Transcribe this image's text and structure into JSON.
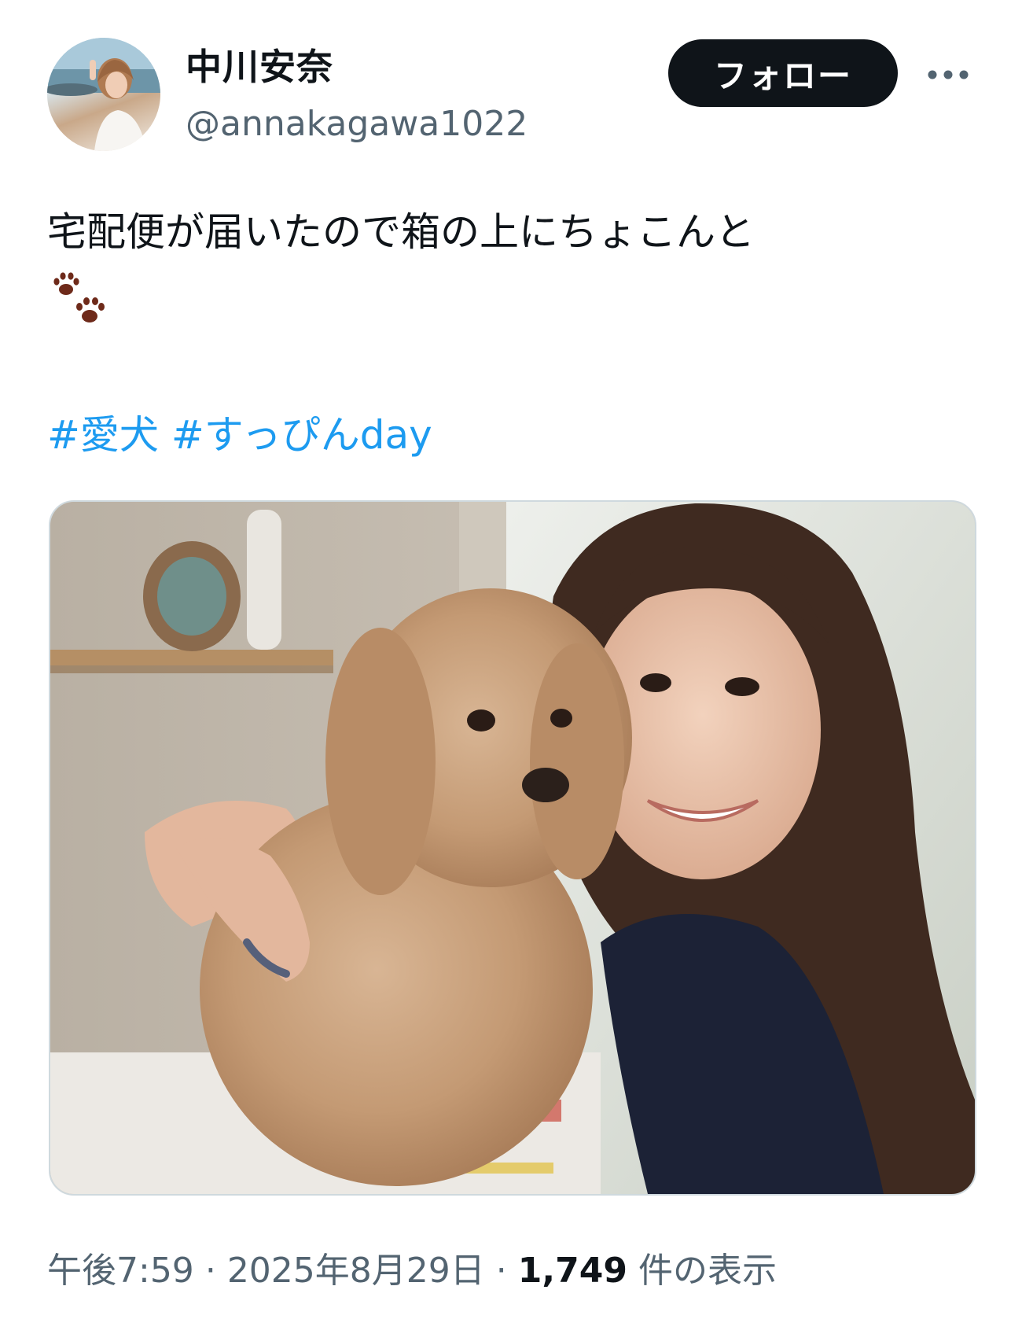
{
  "user": {
    "display_name": "中川安奈",
    "handle": "@annakagawa1022",
    "avatar_icon": "profile-photo"
  },
  "header": {
    "follow_label": "フォロー",
    "more_icon": "more-horizontal-icon"
  },
  "tweet": {
    "text": "宅配便が届いたので箱の上にちょこんと",
    "emoji_icon": "paw-prints-icon",
    "hashtags": [
      "#愛犬",
      "#すっぴんday"
    ]
  },
  "media": {
    "icon": "photo-woman-with-dog"
  },
  "meta": {
    "time": "午後7:59",
    "separator": "·",
    "date": "2025年8月29日",
    "views_count": "1,749",
    "views_label": "件の表示"
  },
  "colors": {
    "text": "#0f1419",
    "secondary": "#536471",
    "link": "#1d9bf0",
    "button_bg": "#0f1419",
    "paw": "#6e2a1a"
  }
}
